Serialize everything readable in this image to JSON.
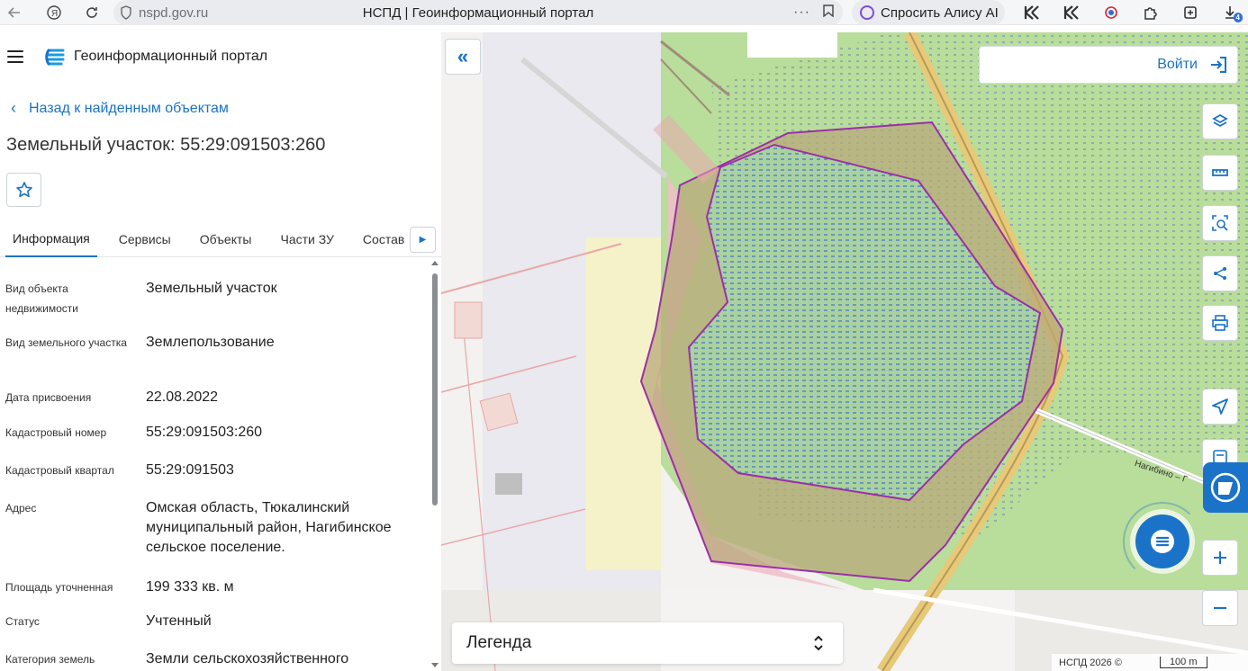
{
  "browser": {
    "url": "nspd.gov.ru",
    "tab_title": "НСПД | Геоинформационный портал",
    "alice_label": "Спросить Алису AI",
    "downloads_badge": "4"
  },
  "header": {
    "portal_title": "Геоинформационный портал"
  },
  "panel": {
    "back_label": "Назад к найденным объектам",
    "object_title": "Земельный участок: 55:29:091503:260",
    "tabs": [
      {
        "label": "Информация"
      },
      {
        "label": "Сервисы"
      },
      {
        "label": "Объекты"
      },
      {
        "label": "Части ЗУ"
      },
      {
        "label": "Состав"
      }
    ],
    "rows": [
      {
        "label": "Вид объекта недвижимости",
        "value": "Земельный участок"
      },
      {
        "label": "Вид земельного участка",
        "value": "Землепользование"
      },
      {
        "label": "Дата присвоения",
        "value": "22.08.2022"
      },
      {
        "label": "Кадастровый номер",
        "value": "55:29:091503:260"
      },
      {
        "label": "Кадастровый квартал",
        "value": "55:29:091503"
      },
      {
        "label": "Адрес",
        "value": "Омская область, Тюкалинский муниципальный район, Нагибинское сельское поселение."
      },
      {
        "label": "Площадь уточненная",
        "value": "199 333 кв. м"
      },
      {
        "label": "Статус",
        "value": "Учтенный"
      },
      {
        "label": "Категория земель",
        "value": "Земли сельскохозяйственного"
      }
    ]
  },
  "map": {
    "login_label": "Войти",
    "legend_label": "Легенда",
    "road_label": "Нагибино – Г",
    "credits": "НСПД 2026 ©",
    "scale_label": "100 m"
  },
  "colors": {
    "accent": "#1a73c8",
    "parcel_outline": "#9b2fa8",
    "forest": "#b9dd9a",
    "wetland_hatch": "#3f6fd0"
  }
}
